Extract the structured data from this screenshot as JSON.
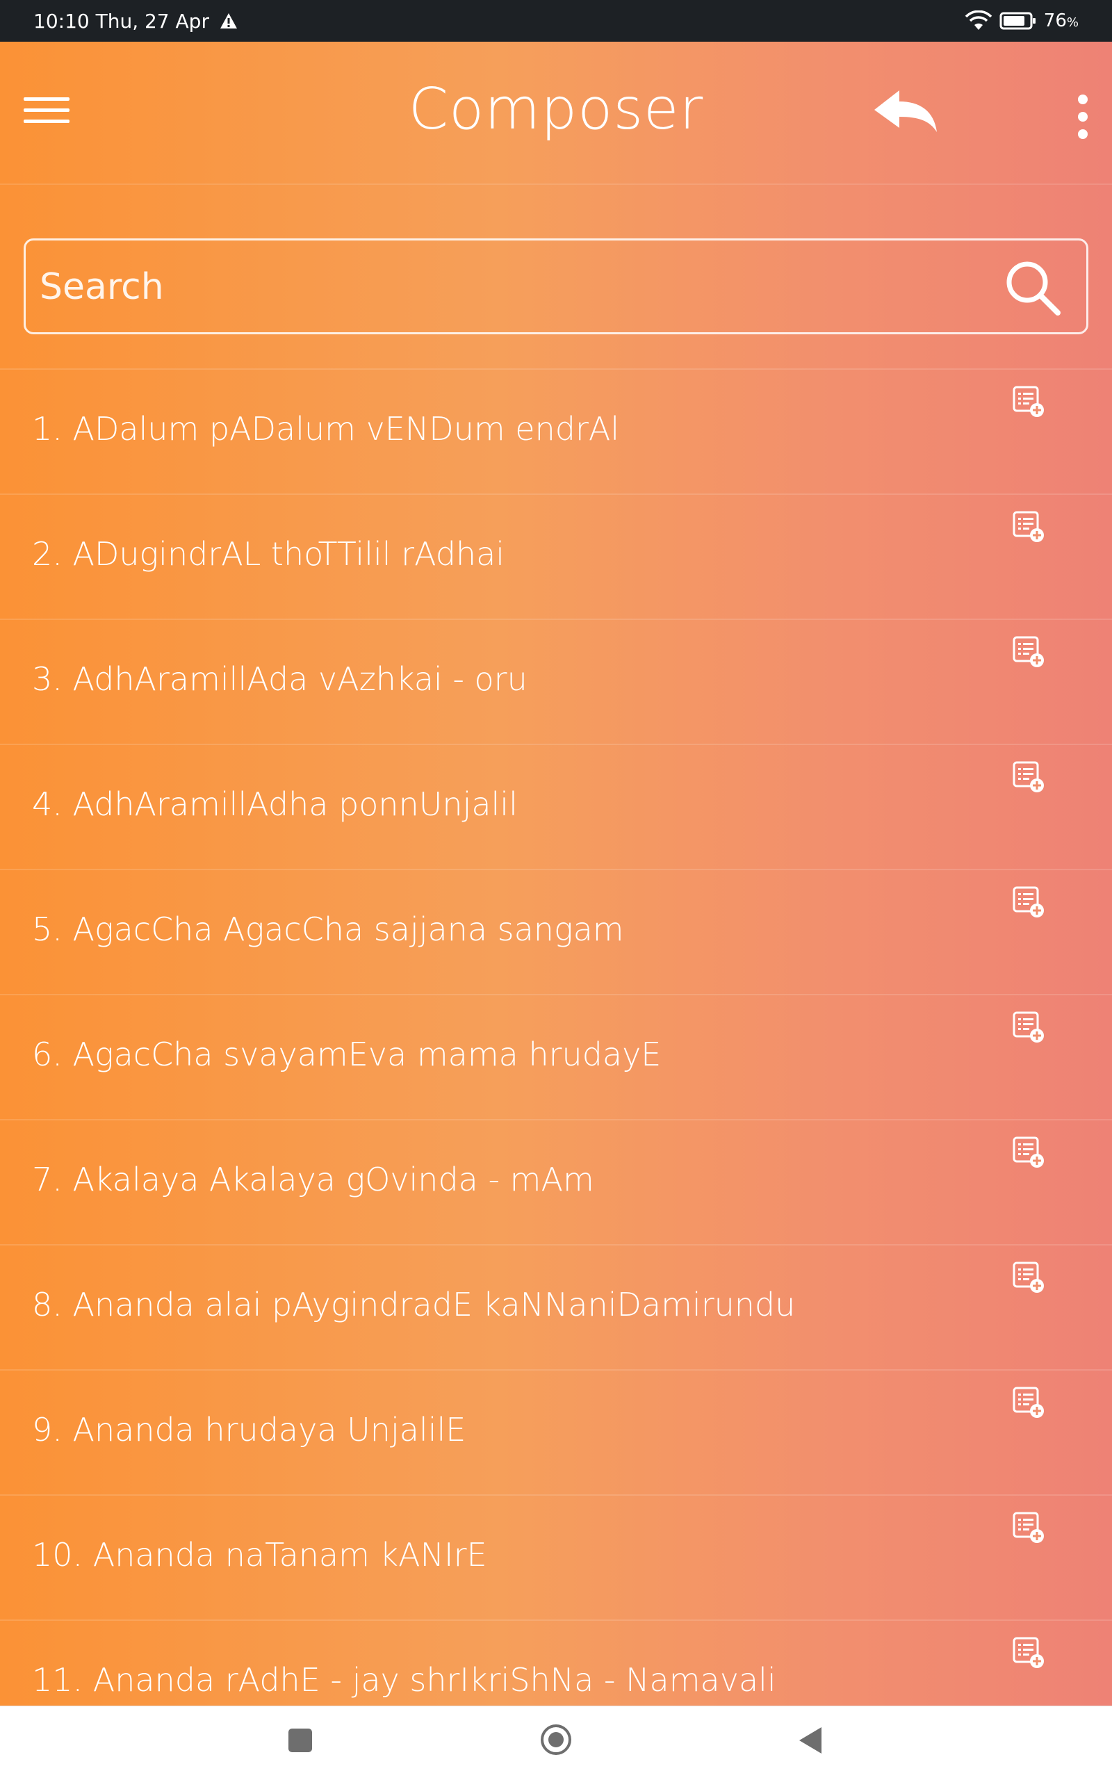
{
  "status_bar": {
    "time_date": "10:10 Thu, 27 Apr",
    "battery_percent": "76",
    "battery_unit": "%",
    "icons": [
      "warning-icon",
      "wifi-icon",
      "battery-icon"
    ]
  },
  "toolbar": {
    "title": "Composer",
    "icons": [
      "hamburger-menu-icon",
      "reply-back-icon",
      "more-vertical-icon"
    ]
  },
  "search": {
    "placeholder": "Search",
    "value": "",
    "icon": "search-icon"
  },
  "list": {
    "items": [
      {
        "label": "1. ADalum pADalum vENDum endrAl"
      },
      {
        "label": "2. ADugindrAL thoTTilil rAdhai"
      },
      {
        "label": "3. AdhAramillAda vAzhkai - oru"
      },
      {
        "label": "4. AdhAramillAdha ponnUnjalil"
      },
      {
        "label": "5. AgacCha AgacCha sajjana sangam"
      },
      {
        "label": "6. AgacCha svayamEva mama hrudayE"
      },
      {
        "label": "7. Akalaya Akalaya gOvinda - mAm"
      },
      {
        "label": "8. Ananda alai pAygindradE kaNNaniDamirundu"
      },
      {
        "label": "9. Ananda hrudaya UnjalilE"
      },
      {
        "label": "10. Ananda naTanam kANIrE"
      },
      {
        "label": "11. Ananda rAdhE - jay shrIkriShNa - Namavali"
      }
    ],
    "item_icon": "add-to-playlist-icon"
  },
  "nav_bar": {
    "icons": [
      "recents-square-icon",
      "home-circle-icon",
      "back-triangle-icon"
    ]
  },
  "colors": {
    "status_bar_bg": "#1d2125",
    "gradient_start": "#fb9236",
    "gradient_end": "#ee8275",
    "text": "#ffffff",
    "nav_icon": "#6e6e6e"
  }
}
